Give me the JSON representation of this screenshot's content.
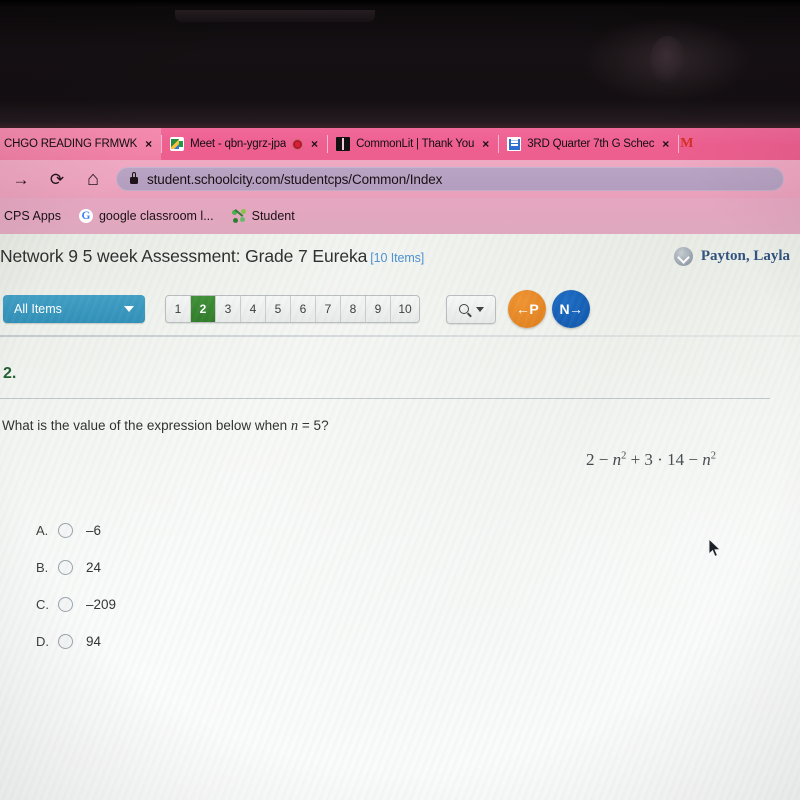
{
  "browser": {
    "tabs": [
      {
        "title": "CHGO READING FRMWK",
        "favicon": "none",
        "close": "×",
        "active": true
      },
      {
        "title": "Meet - qbn-ygrz-jpa",
        "favicon": "google-meet-icon",
        "close": "×",
        "recording": true,
        "active": false
      },
      {
        "title": "CommonLit | Thank You",
        "favicon": "commonlit-book-icon",
        "close": "×",
        "active": false
      },
      {
        "title": "3RD Quarter 7th G Schec",
        "favicon": "google-docs-icon",
        "close": "×",
        "active": false
      },
      {
        "title": "M",
        "favicon": "gmail-icon",
        "close": "",
        "active": false
      }
    ],
    "toolbar": {
      "forward": "→",
      "reload": "⟳",
      "home": "⌂",
      "lock": "lock-icon",
      "url": "student.schoolcity.com/studentcps/Common/Index"
    },
    "bookmarks": [
      {
        "label": "CPS Apps",
        "icon": "none"
      },
      {
        "label": "google classroom l...",
        "icon": "google-icon"
      },
      {
        "label": "Student",
        "icon": "schoolcity-icon"
      }
    ]
  },
  "app": {
    "title": "Network 9 5 week Assessment: Grade 7 Eureka",
    "items_badge": "[10 Items]",
    "student": "Payton, Layla",
    "filter": {
      "label": "All Items"
    },
    "pager": {
      "pages": [
        "1",
        "2",
        "3",
        "4",
        "5",
        "6",
        "7",
        "8",
        "9",
        "10"
      ],
      "current": "2"
    },
    "search_button": "search-dropdown",
    "prev_button": "←P",
    "next_button": "N→",
    "colors": {
      "filter_blue": "#2f8fb8",
      "current_page_green": "#2f7a28",
      "prev_orange": "#de7c18",
      "next_blue": "#0d54a8",
      "badge_blue": "#4a8fd0",
      "student_navy": "#2d4f7c",
      "question_number_green": "#1d5b2e"
    }
  },
  "question": {
    "number": "2.",
    "prompt_before": "What is the value of the expression below when ",
    "prompt_var": "n",
    "prompt_after": " = 5?",
    "expression": {
      "t1": "2 − ",
      "v1": "n",
      "e1": "2",
      "t2": " + 3 · 14 − ",
      "v2": "n",
      "e2": "2"
    },
    "choices": [
      {
        "letter": "A.",
        "value": "–6"
      },
      {
        "letter": "B.",
        "value": "24"
      },
      {
        "letter": "C.",
        "value": "–209"
      },
      {
        "letter": "D.",
        "value": "94"
      }
    ]
  }
}
